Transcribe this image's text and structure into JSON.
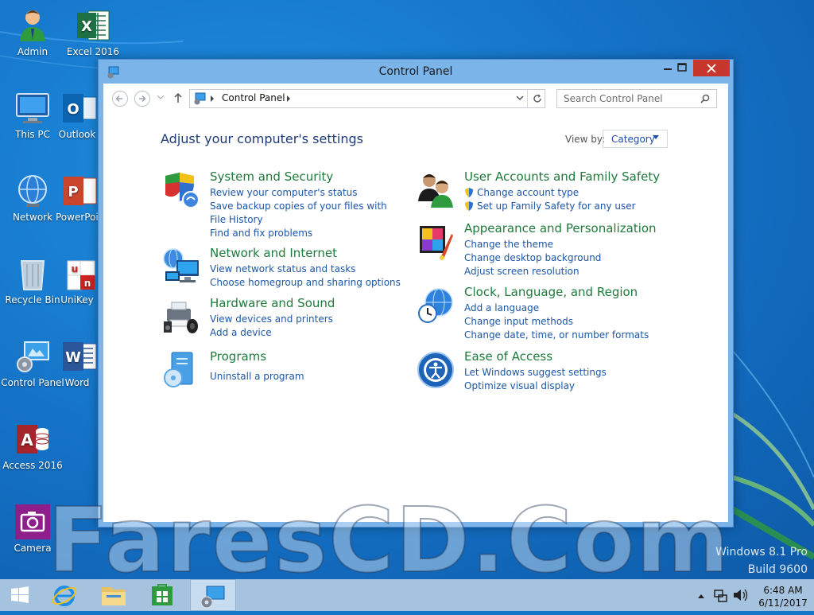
{
  "colors": {
    "desktop": "#1677c9",
    "taskbar": "#a5c2de",
    "category_title": "#1f7a3b",
    "link": "#1c56a8",
    "heading": "#1e3a75",
    "close_button": "#c7372e"
  },
  "desktop_icons": [
    {
      "label": "Admin",
      "icon": "user-icon"
    },
    {
      "label": "Excel 2016",
      "icon": "excel-icon"
    },
    {
      "label": "This PC",
      "icon": "computer-icon"
    },
    {
      "label": "Outlook",
      "icon": "outlook-icon"
    },
    {
      "label": "Network",
      "icon": "network-globe-icon"
    },
    {
      "label": "PowerPoint 2016",
      "icon": "powerpoint-icon"
    },
    {
      "label": "Recycle Bin",
      "icon": "recycle-bin-icon"
    },
    {
      "label": "UniKey",
      "icon": "unikey-icon"
    },
    {
      "label": "Control Panel",
      "icon": "control-panel-icon"
    },
    {
      "label": "Word",
      "icon": "word-icon"
    },
    {
      "label": "Access 2016",
      "icon": "access-icon"
    },
    {
      "label": "Camera",
      "icon": "camera-icon"
    }
  ],
  "window": {
    "title": "Control Panel",
    "breadcrumb": "Control Panel",
    "search_placeholder": "Search Control Panel",
    "heading": "Adjust your computer's settings",
    "view_by_label": "View by:",
    "view_by_value": "Category"
  },
  "categories": [
    {
      "title": "System and Security",
      "icon": "system-security-icon",
      "links": [
        "Review your computer's status",
        "Save backup copies of your files with File History",
        "Find and fix problems"
      ]
    },
    {
      "title": "Network and Internet",
      "icon": "network-internet-icon",
      "links": [
        "View network status and tasks",
        "Choose homegroup and sharing options"
      ]
    },
    {
      "title": "Hardware and Sound",
      "icon": "hardware-sound-icon",
      "links": [
        "View devices and printers",
        "Add a device"
      ]
    },
    {
      "title": "Programs",
      "icon": "programs-icon",
      "links": [
        "Uninstall a program"
      ]
    },
    {
      "title": "User Accounts and Family Safety",
      "icon": "user-accounts-icon",
      "links": [
        "Change account type",
        "Set up Family Safety for any user"
      ]
    },
    {
      "title": "Appearance and Personalization",
      "icon": "appearance-icon",
      "links": [
        "Change the theme",
        "Change desktop background",
        "Adjust screen resolution"
      ]
    },
    {
      "title": "Clock, Language, and Region",
      "icon": "clock-region-icon",
      "links": [
        "Add a language",
        "Change input methods",
        "Change date, time, or number formats"
      ]
    },
    {
      "title": "Ease of Access",
      "icon": "ease-of-access-icon",
      "links": [
        "Let Windows suggest settings",
        "Optimize visual display"
      ]
    }
  ],
  "watermark": {
    "text": "FaresCD.Com",
    "os_line1": "Windows 8.1 Pro",
    "os_line2": "Build 9600"
  },
  "taskbar": {
    "time": "6:48 AM",
    "date": "6/11/2017"
  }
}
